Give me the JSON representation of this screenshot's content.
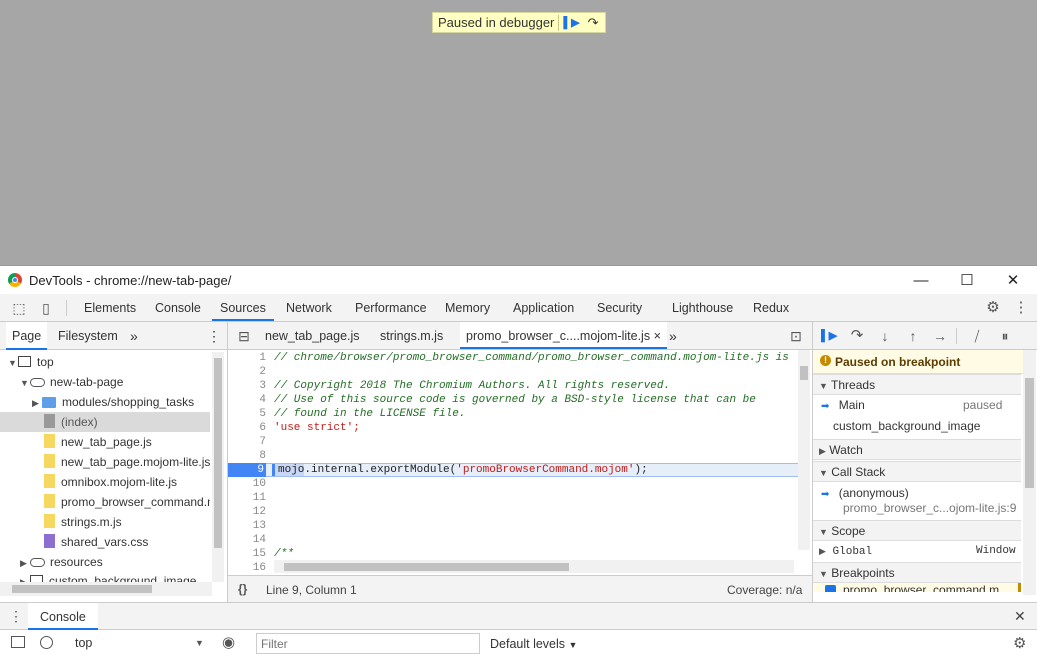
{
  "banner": {
    "text": "Paused in debugger"
  },
  "window": {
    "title": "DevTools - chrome://new-tab-page/"
  },
  "main_tabs": [
    "Elements",
    "Console",
    "Sources",
    "Network",
    "Performance",
    "Memory",
    "Application",
    "Security",
    "Lighthouse",
    "Redux"
  ],
  "active_main_tab": "Sources",
  "navigator": {
    "tabs": [
      "Page",
      "Filesystem"
    ],
    "more": "»",
    "tree": [
      {
        "label": "top"
      },
      {
        "label": "new-tab-page"
      },
      {
        "label": "modules/shopping_tasks"
      },
      {
        "label": "(index)"
      },
      {
        "label": "new_tab_page.js"
      },
      {
        "label": "new_tab_page.mojom-lite.js"
      },
      {
        "label": "omnibox.mojom-lite.js"
      },
      {
        "label": "promo_browser_command.mojom-lite.js"
      },
      {
        "label": "strings.m.js"
      },
      {
        "label": "shared_vars.css"
      },
      {
        "label": "resources"
      },
      {
        "label": "custom_background_image"
      }
    ]
  },
  "editor": {
    "tabs": [
      "new_tab_page.js",
      "strings.m.js",
      "promo_browser_c....mojom-lite.js"
    ],
    "close": "×",
    "more": "»",
    "lines": [
      {
        "n": "1",
        "text": "// chrome/browser/promo_browser_command/promo_browser_command.mojom-lite.js is",
        "kind": "comment"
      },
      {
        "n": "2",
        "text": "",
        "kind": "plain"
      },
      {
        "n": "3",
        "text": "// Copyright 2018 The Chromium Authors. All rights reserved.",
        "kind": "comment"
      },
      {
        "n": "4",
        "text": "// Use of this source code is governed by a BSD-style license that can be",
        "kind": "comment"
      },
      {
        "n": "5",
        "text": "// found in the LICENSE file.",
        "kind": "comment"
      },
      {
        "n": "6",
        "text": "'use strict';",
        "kind": "string"
      },
      {
        "n": "7",
        "text": "",
        "kind": "plain"
      },
      {
        "n": "8",
        "text": "",
        "kind": "plain"
      },
      {
        "n": "9",
        "text": "mojo.internal.exportModule('promoBrowserCommand.mojom');",
        "kind": "bp"
      },
      {
        "n": "10",
        "text": "",
        "kind": "plain"
      },
      {
        "n": "11",
        "text": "",
        "kind": "plain"
      },
      {
        "n": "12",
        "text": "",
        "kind": "plain"
      },
      {
        "n": "13",
        "text": "",
        "kind": "plain"
      },
      {
        "n": "14",
        "text": "",
        "kind": "plain"
      },
      {
        "n": "15",
        "text": "/**",
        "kind": "comment"
      },
      {
        "n": "16",
        "text": "",
        "kind": "plain"
      }
    ],
    "bp_code": {
      "a": "mojo",
      "b": ".internal.",
      "c": "exportModule(",
      "d": "'promoBrowserCommand.mojom'",
      "e": ");"
    },
    "status": {
      "braces": "{}",
      "cursor": "Line 9, Column 1",
      "coverage": "Coverage: n/a"
    }
  },
  "debugger": {
    "paused_msg": "Paused on breakpoint",
    "threads_label": "Threads",
    "threads": [
      {
        "name": "Main",
        "state": "paused"
      },
      {
        "name": "custom_background_image",
        "state": ""
      }
    ],
    "watch_label": "Watch",
    "callstack_label": "Call Stack",
    "callstack": [
      {
        "fn": "(anonymous)",
        "loc": "promo_browser_c...ojom-lite.js:9"
      }
    ],
    "scope_label": "Scope",
    "scope": [
      {
        "name": "Global",
        "value": "Window"
      }
    ],
    "breakpoints_label": "Breakpoints",
    "breakpoint_item": "promo_browser_command.m"
  },
  "drawer": {
    "tab": "Console",
    "context": "top",
    "filter_placeholder": "Filter",
    "levels": "Default levels"
  },
  "colors": {
    "accent": "#1a73e8",
    "breakpoint": "#4285f4",
    "banner": "#ffffc2"
  }
}
